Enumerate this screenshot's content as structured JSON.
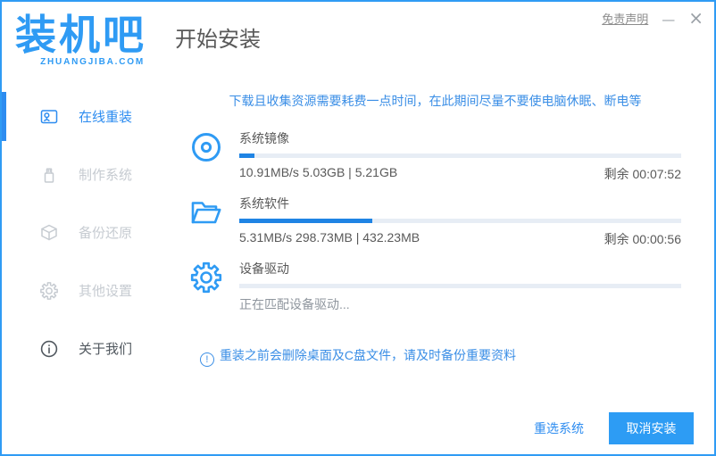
{
  "window": {
    "disclaimer": "免责声明",
    "minimize_glyph": "—",
    "close_glyph": "×"
  },
  "brand": {
    "name": "装机吧",
    "domain": "ZHUANGJIBA.COM"
  },
  "header": {
    "title": "开始安装"
  },
  "sidebar": {
    "items": [
      {
        "label": "在线重装",
        "icon": "monitor-icon",
        "state": "active"
      },
      {
        "label": "制作系统",
        "icon": "usb-icon",
        "state": "disabled"
      },
      {
        "label": "备份还原",
        "icon": "box-icon",
        "state": "disabled"
      },
      {
        "label": "其他设置",
        "icon": "gear-icon",
        "state": "disabled"
      },
      {
        "label": "关于我们",
        "icon": "info-icon",
        "state": "normal"
      }
    ]
  },
  "main": {
    "notice_top": "下载且收集资源需要耗费一点时间，在此期间尽量不要使电脑休眠、断电等",
    "tasks": [
      {
        "name": "系统镜像",
        "icon": "disc-icon",
        "progress_percent": 3.5,
        "detail": "10.91MB/s 5.03GB | 5.21GB",
        "remaining": "剩余 00:07:52"
      },
      {
        "name": "系统软件",
        "icon": "folder-icon",
        "progress_percent": 30,
        "detail": "5.31MB/s 298.73MB | 432.23MB",
        "remaining": "剩余 00:00:56"
      },
      {
        "name": "设备驱动",
        "icon": "gear-icon",
        "progress_percent": 0,
        "detail": "正在匹配设备驱动...",
        "remaining": ""
      }
    ],
    "notice_bottom": "重装之前会删除桌面及C盘文件，请及时备份重要资料",
    "warning_glyph": "!"
  },
  "footer": {
    "reselect_label": "重选系统",
    "cancel_label": "取消安装"
  },
  "colors": {
    "primary": "#2f9bf4",
    "active_link": "#2d8cf0",
    "progress_fill": "#1f84e4",
    "progress_track": "#e7edf5",
    "notice_blue": "#3a8ee6"
  }
}
